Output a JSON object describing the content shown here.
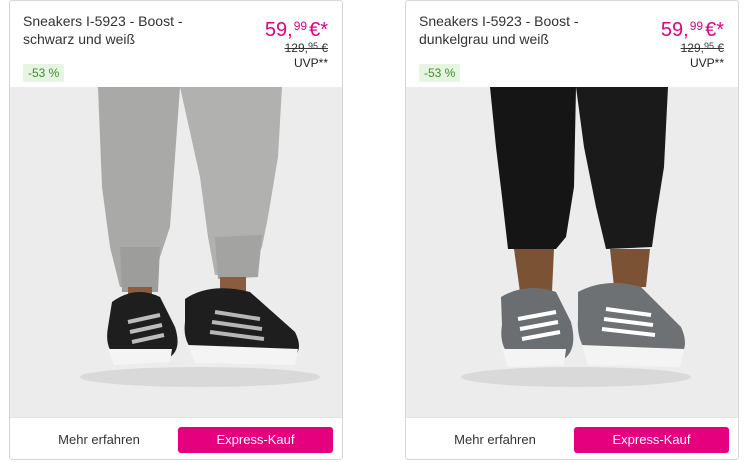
{
  "products": [
    {
      "title": "Sneakers I-5923 - Boost - schwarz und weiß",
      "price_main": "59,",
      "price_cents": "99",
      "price_suffix": "€*",
      "old_price_main": "129,",
      "old_price_cents": "95",
      "old_price_suffix": " €",
      "uvp_label": "UVP**",
      "discount_badge": "-53 %",
      "image_icon": "sneaker-photo-black-white",
      "more_label": "Mehr erfahren",
      "express_label": "Express-Kauf"
    },
    {
      "title": "Sneakers I-5923 - Boost - dunkelgrau und weiß",
      "price_main": "59,",
      "price_cents": "99",
      "price_suffix": "€*",
      "old_price_main": "129,",
      "old_price_cents": "95",
      "old_price_suffix": " €",
      "uvp_label": "UVP**",
      "discount_badge": "-53 %",
      "image_icon": "sneaker-photo-dark-grey-white",
      "more_label": "Mehr erfahren",
      "express_label": "Express-Kauf"
    }
  ],
  "colors": {
    "accent": "#e5007e",
    "badge_bg": "#e6f5e1",
    "badge_text": "#3a8f2c",
    "photo_bg": "#ececec"
  }
}
